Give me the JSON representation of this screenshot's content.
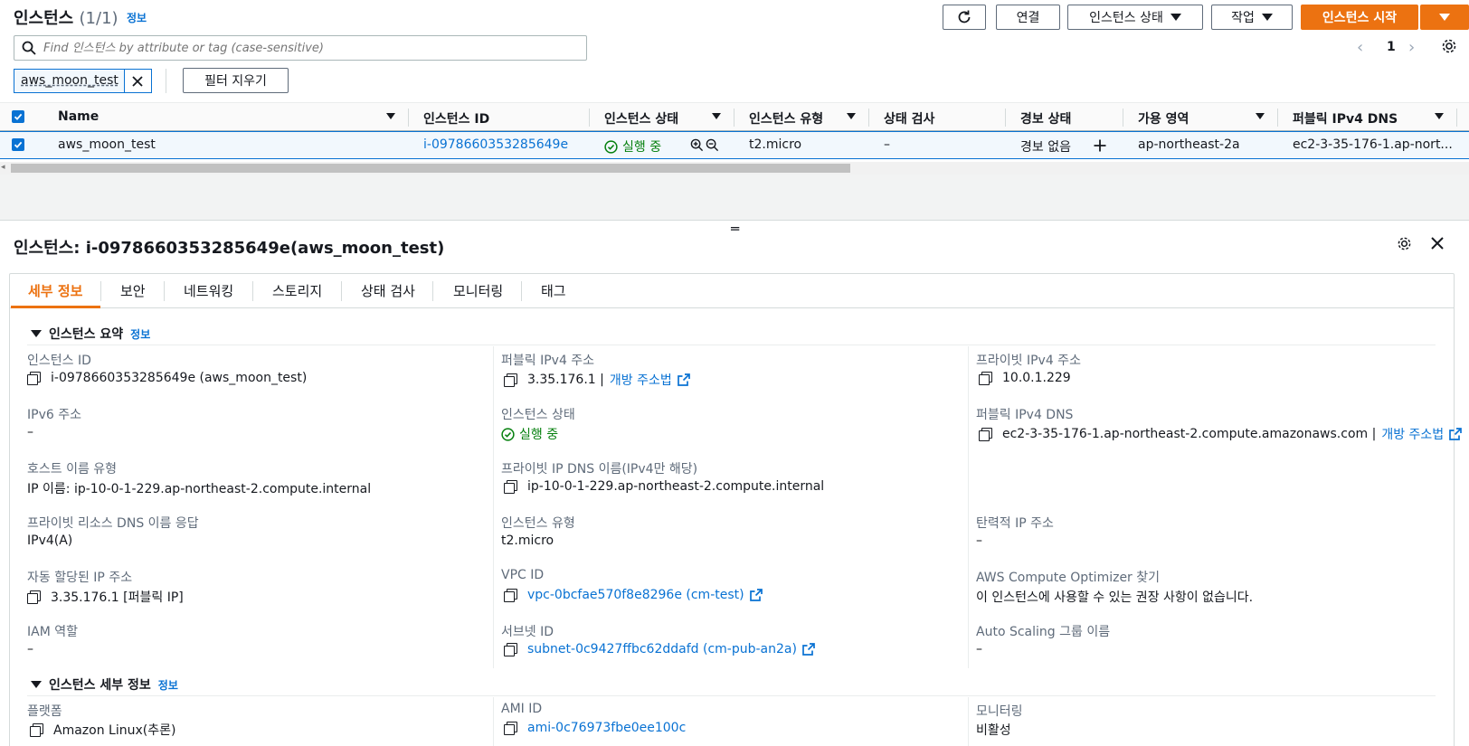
{
  "header": {
    "title": "인스턴스",
    "count": "(1/1)",
    "info": "정보",
    "buttons": {
      "connect": "연결",
      "instance_state": "인스턴스 상태",
      "actions": "작업",
      "launch": "인스턴스 시작"
    }
  },
  "search": {
    "placeholder": "Find 인스턴스 by attribute or tag (case-sensitive)",
    "value": ""
  },
  "pagination": {
    "page": "1"
  },
  "filter": {
    "token": "aws_moon_test",
    "clear_label": "필터 지우기"
  },
  "table": {
    "columns": [
      "Name",
      "인스턴스 ID",
      "인스턴스 상태",
      "인스턴스 유형",
      "상태 검사",
      "경보 상태",
      "가용 영역",
      "퍼블릭 IPv4 DNS"
    ],
    "row": {
      "name": "aws_moon_test",
      "instance_id": "i-0978660353285649e",
      "state": "실행 중",
      "type": "t2.micro",
      "status_check": "–",
      "alarm": "경보 없음",
      "az": "ap-northeast-2a",
      "dns": "ec2-3-35-176-1.ap-nort..."
    }
  },
  "details": {
    "title": "인스턴스: i-0978660353285649e(aws_moon_test)",
    "tabs": [
      "세부 정보",
      "보안",
      "네트워킹",
      "스토리지",
      "상태 검사",
      "모니터링",
      "태그"
    ],
    "summary": {
      "heading": "인스턴스 요약",
      "info": "정보",
      "col1": [
        {
          "label": "인스턴스 ID",
          "value": "i-0978660353285649e (aws_moon_test)"
        },
        {
          "label": "IPv6 주소",
          "value": "–"
        },
        {
          "label": "호스트 이름 유형",
          "value": "IP 이름: ip-10-0-1-229.ap-northeast-2.compute.internal"
        },
        {
          "label": "프라이빗 리소스 DNS 이름 응답",
          "value": "IPv4(A)"
        },
        {
          "label": "자동 할당된 IP 주소",
          "value": "3.35.176.1 [퍼블릭 IP]"
        },
        {
          "label": "IAM 역할",
          "value": "–"
        }
      ],
      "col2": [
        {
          "label": "퍼블릭 IPv4 주소",
          "value": "3.35.176.1 |",
          "link": "개방 주소법"
        },
        {
          "label": "인스턴스 상태",
          "value": "실행 중"
        },
        {
          "label": "프라이빗 IP DNS 이름(IPv4만 해당)",
          "value": "ip-10-0-1-229.ap-northeast-2.compute.internal"
        },
        {
          "label": "인스턴스 유형",
          "value": "t2.micro"
        },
        {
          "label": "VPC ID",
          "value": "vpc-0bcfae570f8e8296e (cm-test)"
        },
        {
          "label": "서브넷 ID",
          "value": "subnet-0c9427ffbc62ddafd (cm-pub-an2a)"
        }
      ],
      "col3": [
        {
          "label": "프라이빗 IPv4 주소",
          "value": "10.0.1.229"
        },
        {
          "label": "퍼블릭 IPv4 DNS",
          "value": "ec2-3-35-176-1.ap-northeast-2.compute.amazonaws.com |",
          "link": "개방 주소법"
        },
        {
          "label": "탄력적 IP 주소",
          "value": "–"
        },
        {
          "label": "AWS Compute Optimizer 찾기",
          "value": "이 인스턴스에 사용할 수 있는 권장 사항이 없습니다."
        },
        {
          "label": "Auto Scaling 그룹 이름",
          "value": "–"
        }
      ]
    },
    "instance_details": {
      "heading": "인스턴스 세부 정보",
      "info": "정보",
      "platform_label": "플랫폼",
      "platform": "Amazon Linux(추론)",
      "ami_label": "AMI ID",
      "ami": "ami-0c76973fbe0ee100c",
      "monitoring_label": "모니터링",
      "monitoring": "비활성"
    }
  },
  "colors": {
    "accent": "#ec7211",
    "link": "#0972d3",
    "success": "#037f0c"
  }
}
